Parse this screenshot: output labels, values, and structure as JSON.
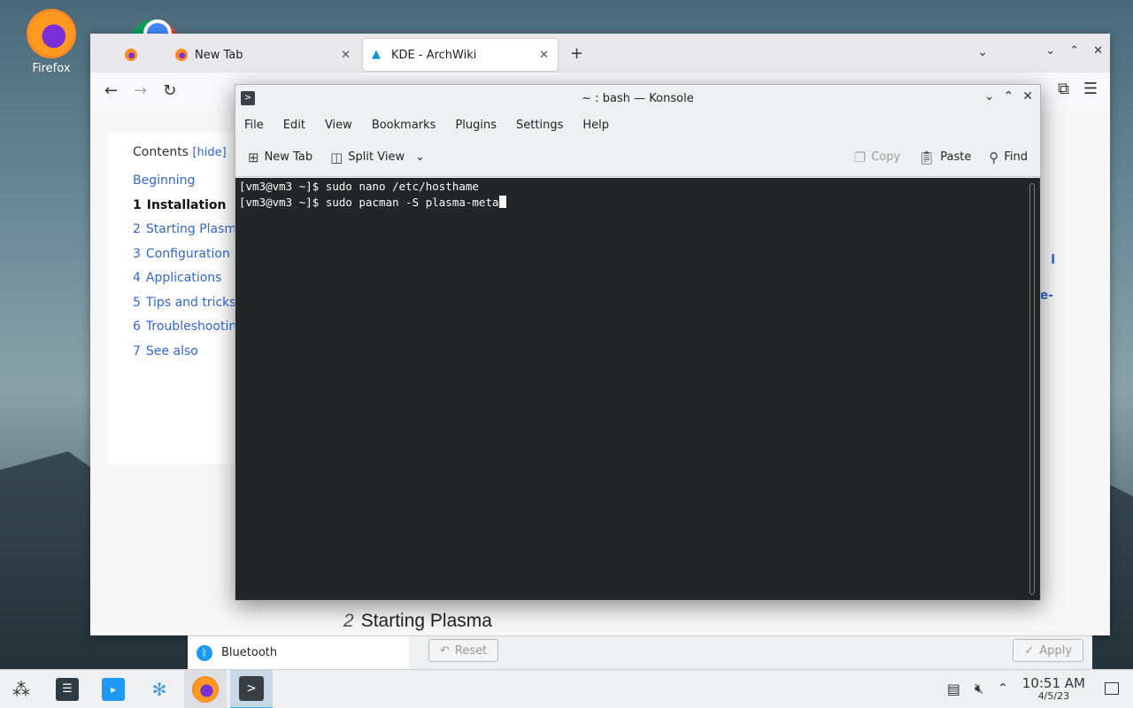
{
  "desktop": {
    "icons": [
      {
        "label": "Firefox",
        "icon": "firefox-icon"
      },
      {
        "label": "",
        "icon": "chrome-icon"
      }
    ]
  },
  "browser": {
    "tabs": [
      {
        "label": "",
        "icon": "firefox-favicon"
      },
      {
        "label": "New Tab",
        "icon": "firefox-favicon"
      },
      {
        "label": "KDE - ArchWiki",
        "icon": "archlinux-favicon"
      }
    ],
    "new_tab_symbol": "+",
    "toc": {
      "title": "Contents",
      "hide_link": "[hide]",
      "items": [
        {
          "num": "",
          "label": "Beginning",
          "expandable": false,
          "bold": false
        },
        {
          "num": "1",
          "label": "Installation",
          "expandable": true,
          "bold": true
        },
        {
          "num": "2",
          "label": "Starting Plasma",
          "expandable": true,
          "bold": false
        },
        {
          "num": "3",
          "label": "Configuration",
          "expandable": true,
          "bold": false
        },
        {
          "num": "4",
          "label": "Applications",
          "expandable": true,
          "bold": false
        },
        {
          "num": "5",
          "label": "Tips and tricks",
          "expandable": true,
          "bold": false
        },
        {
          "num": "6",
          "label": "Troubleshooting",
          "expandable": true,
          "bold": false
        },
        {
          "num": "7",
          "label": "See also",
          "expandable": false,
          "bold": false
        }
      ]
    },
    "section_heading": {
      "num": "2",
      "title": "Starting Plasma"
    },
    "side_fragments": [
      "l",
      "e-"
    ]
  },
  "settings_dialog": {
    "bluetooth_label": "Bluetooth",
    "reset_label": "Reset",
    "apply_label": "Apply"
  },
  "konsole": {
    "title": "~ : bash — Konsole",
    "menu": [
      "File",
      "Edit",
      "View",
      "Bookmarks",
      "Plugins",
      "Settings",
      "Help"
    ],
    "toolbar": {
      "new_tab": "New Tab",
      "split_view": "Split View",
      "copy": "Copy",
      "paste": "Paste",
      "find": "Find"
    },
    "terminal_lines": [
      "[vm3@vm3 ~]$ sudo nano /etc/hosthame",
      "[vm3@vm3 ~]$ sudo pacman -S plasma-meta"
    ]
  },
  "taskbar": {
    "apps": [
      "application-launcher-icon",
      "system-settings-icon",
      "discover-icon",
      "plasma-icon",
      "firefox-icon",
      "konsole-icon"
    ],
    "clock_time": "10:51 AM",
    "clock_date": "4/5/23"
  }
}
